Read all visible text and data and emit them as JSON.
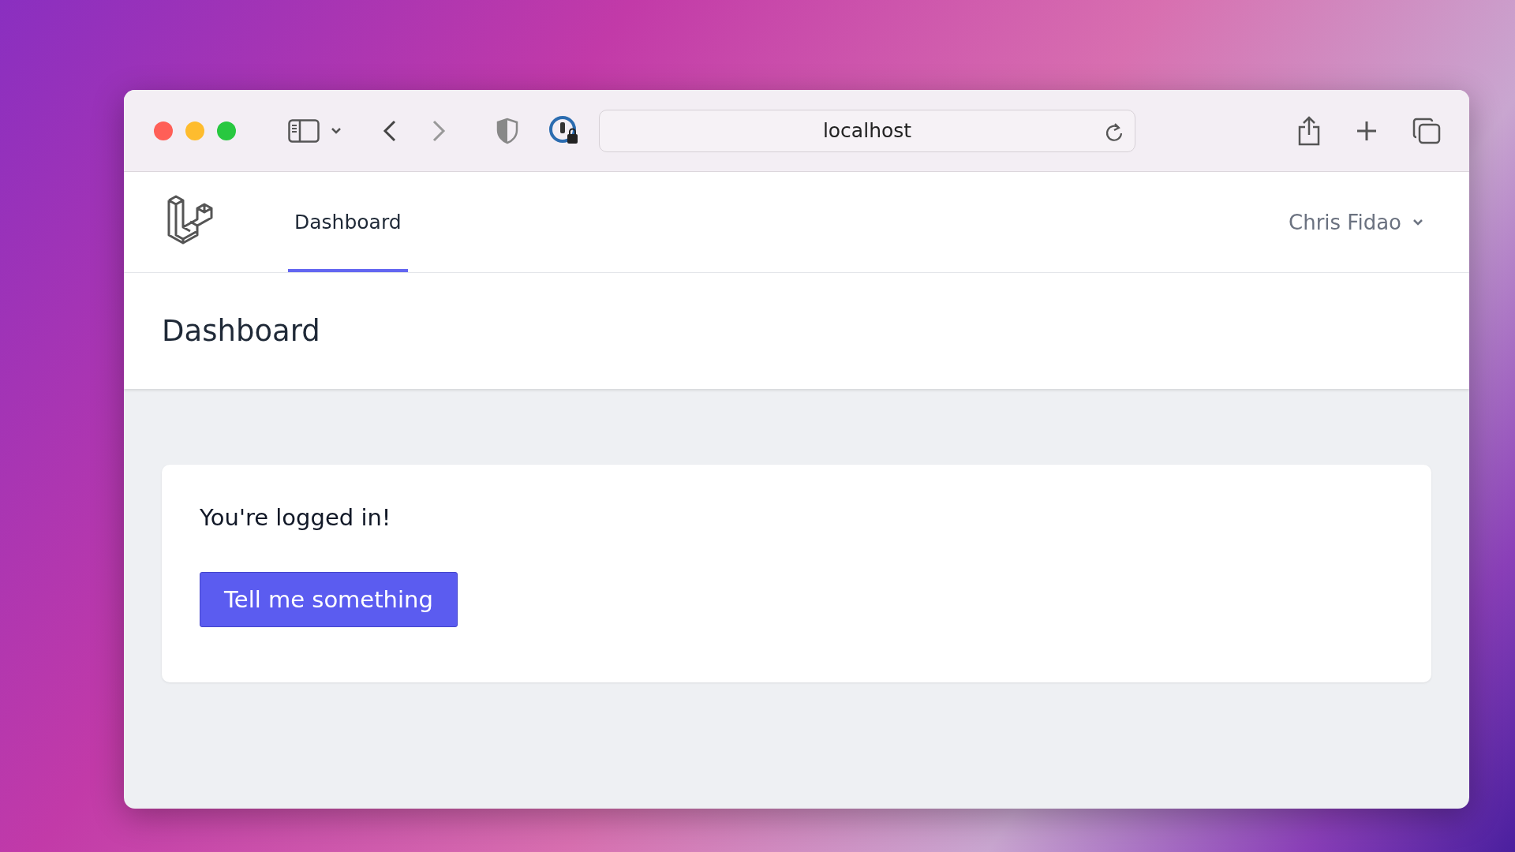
{
  "browser": {
    "address": "localhost"
  },
  "nav": {
    "links": [
      {
        "label": "Dashboard",
        "selected": true
      }
    ],
    "user": "Chris Fidao"
  },
  "header": {
    "title": "Dashboard"
  },
  "card": {
    "message": "You're logged in!",
    "button": "Tell me something"
  }
}
